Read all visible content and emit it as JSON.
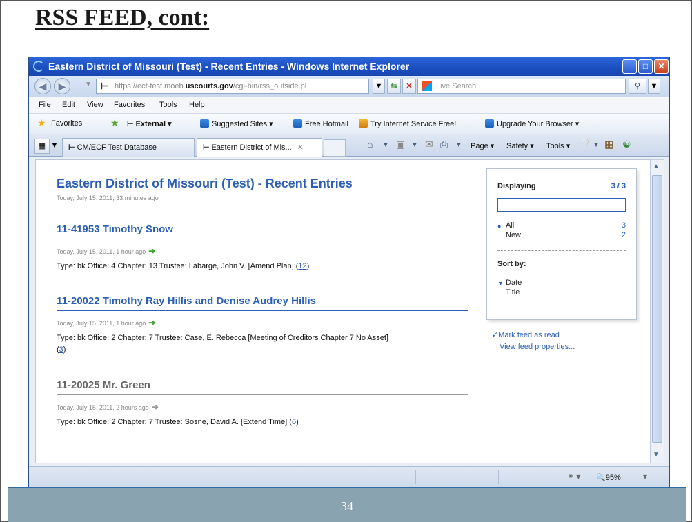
{
  "slide": {
    "title": "RSS FEED, cont:",
    "page_number": "34"
  },
  "window": {
    "title": "Eastern District of Missouri (Test) - Recent Entries - Windows Internet Explorer",
    "minimize": "_",
    "maximize": "□",
    "close": "✕"
  },
  "address": {
    "url_prefix": "https://ecf-test.moeb.",
    "url_domain": "uscourts.gov",
    "url_path": "/cgi-bin/rss_outside.pl",
    "search_placeholder": "Live Search"
  },
  "menu": [
    "File",
    "Edit",
    "View",
    "Favorites",
    "Tools",
    "Help"
  ],
  "favorites_bar": {
    "favorites_label": "Favorites",
    "external": "External ▾",
    "suggested": "Suggested Sites ▾",
    "hotmail": "Free Hotmail",
    "isp": "Try Internet Service Free!",
    "upgrade": "Upgrade Your Browser ▾"
  },
  "tabs": [
    {
      "label": "CM/ECF Test Database"
    },
    {
      "label": "Eastern District of Mis...",
      "close": "✕"
    }
  ],
  "command_bar": {
    "page": "Page ▾",
    "safety": "Safety ▾",
    "tools": "Tools ▾"
  },
  "feed": {
    "title": "Eastern District of Missouri (Test) - Recent Entries",
    "date": "Today, July 15, 2011, 33 minutes ago",
    "entries": [
      {
        "title": "11-41953 Timothy Snow",
        "date": "Today, July 15, 2011, 1 hour ago",
        "desc": "Type: bk Office: 4 Chapter: 13 Trustee: Labarge, John V. [Amend Plan]",
        "link": "12",
        "arrow": "➔"
      },
      {
        "title": "11-20022 Timothy Ray Hillis and Denise Audrey Hillis",
        "date": "Today, July 15, 2011, 1 hour ago",
        "desc": "Type: bk Office: 2 Chapter: 7 Trustee: Case, E. Rebecca [Meeting of Creditors Chapter 7 No Asset]",
        "link": "3",
        "arrow": "➔"
      },
      {
        "title": "11-20025 Mr. Green",
        "date": "Today, July 15, 2011, 2 hours ago",
        "desc": "Type: bk Office: 2 Chapter: 7 Trustee: Sosne, David A. [Extend Time]",
        "link": "6",
        "arrow": "➔"
      }
    ]
  },
  "sidebar": {
    "displaying_label": "Displaying",
    "displaying_count": "3 / 3",
    "filters": [
      {
        "label": "All",
        "count": "3"
      },
      {
        "label": "New",
        "count": "2"
      }
    ],
    "sort_label": "Sort by:",
    "sort_options": [
      "Date",
      "Title"
    ],
    "mark_read": "Mark feed as read",
    "view_props": "View feed properties..."
  },
  "status": {
    "zoom": "95%"
  },
  "colors": {
    "link_blue": "#2c5fb3",
    "titlebar_blue": "#1a4fc0",
    "green_arrow": "#3aa52a"
  }
}
